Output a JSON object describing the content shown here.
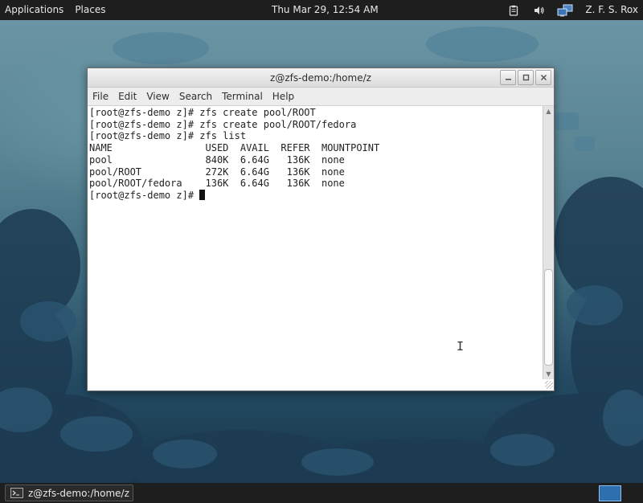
{
  "top_panel": {
    "applications": "Applications",
    "places": "Places",
    "clock": "Thu Mar 29, 12:54 AM",
    "user": "Z. F. S. Rox",
    "tray_icons": [
      "clipboard-icon",
      "volume-icon",
      "network-icon"
    ]
  },
  "window": {
    "title": "z@zfs-demo:/home/z",
    "buttons": [
      "minimize-icon",
      "maximize-icon",
      "close-icon"
    ],
    "menu": [
      "File",
      "Edit",
      "View",
      "Search",
      "Terminal",
      "Help"
    ]
  },
  "terminal": {
    "lines": [
      "[root@zfs-demo z]# zfs create pool/ROOT",
      "[root@zfs-demo z]# zfs create pool/ROOT/fedora",
      "[root@zfs-demo z]# zfs list",
      "NAME                USED  AVAIL  REFER  MOUNTPOINT",
      "pool                840K  6.64G   136K  none",
      "pool/ROOT           272K  6.64G   136K  none",
      "pool/ROOT/fedora    136K  6.64G   136K  none"
    ],
    "prompt": "[root@zfs-demo z]# "
  },
  "taskbar": {
    "task_label": "z@zfs-demo:/home/z",
    "task_icon": "terminal-icon",
    "workspace_icon": "workspace-switcher-icon"
  }
}
